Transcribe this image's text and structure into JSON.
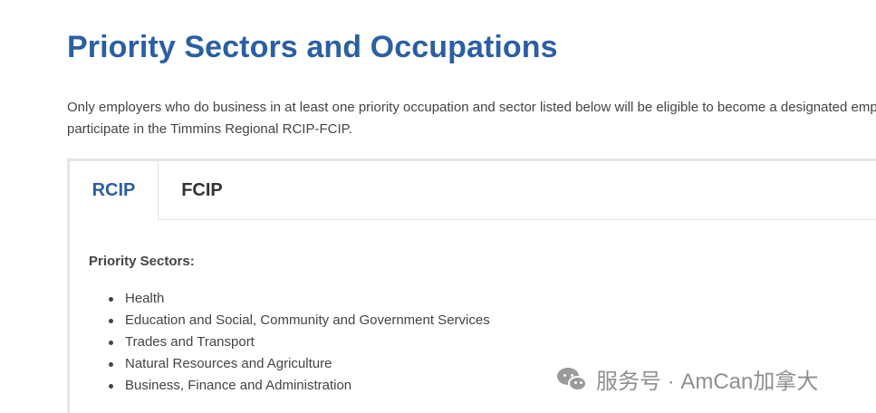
{
  "page": {
    "title": "Priority Sectors and Occupations",
    "intro_line1": "Only employers who do business in at least one priority occupation and sector listed below will be eligible to become a designated employer and",
    "intro_line2": "participate in the Timmins Regional RCIP-FCIP."
  },
  "tabs": [
    {
      "label": "RCIP",
      "active": true
    },
    {
      "label": "FCIP",
      "active": false
    }
  ],
  "rcip": {
    "heading": "Priority Sectors:",
    "sectors": [
      "Health",
      "Education and Social, Community and Government Services",
      "Trades and Transport",
      "Natural Resources and Agriculture",
      "Business, Finance and Administration"
    ]
  },
  "watermark": {
    "text": "服务号 · AmCan加拿大",
    "icon": "wechat-icon"
  },
  "colors": {
    "title": "#2b5fa3",
    "active_tab": "#2b5fa3",
    "body_text": "#444444",
    "panel_border": "#e6e6e6"
  }
}
